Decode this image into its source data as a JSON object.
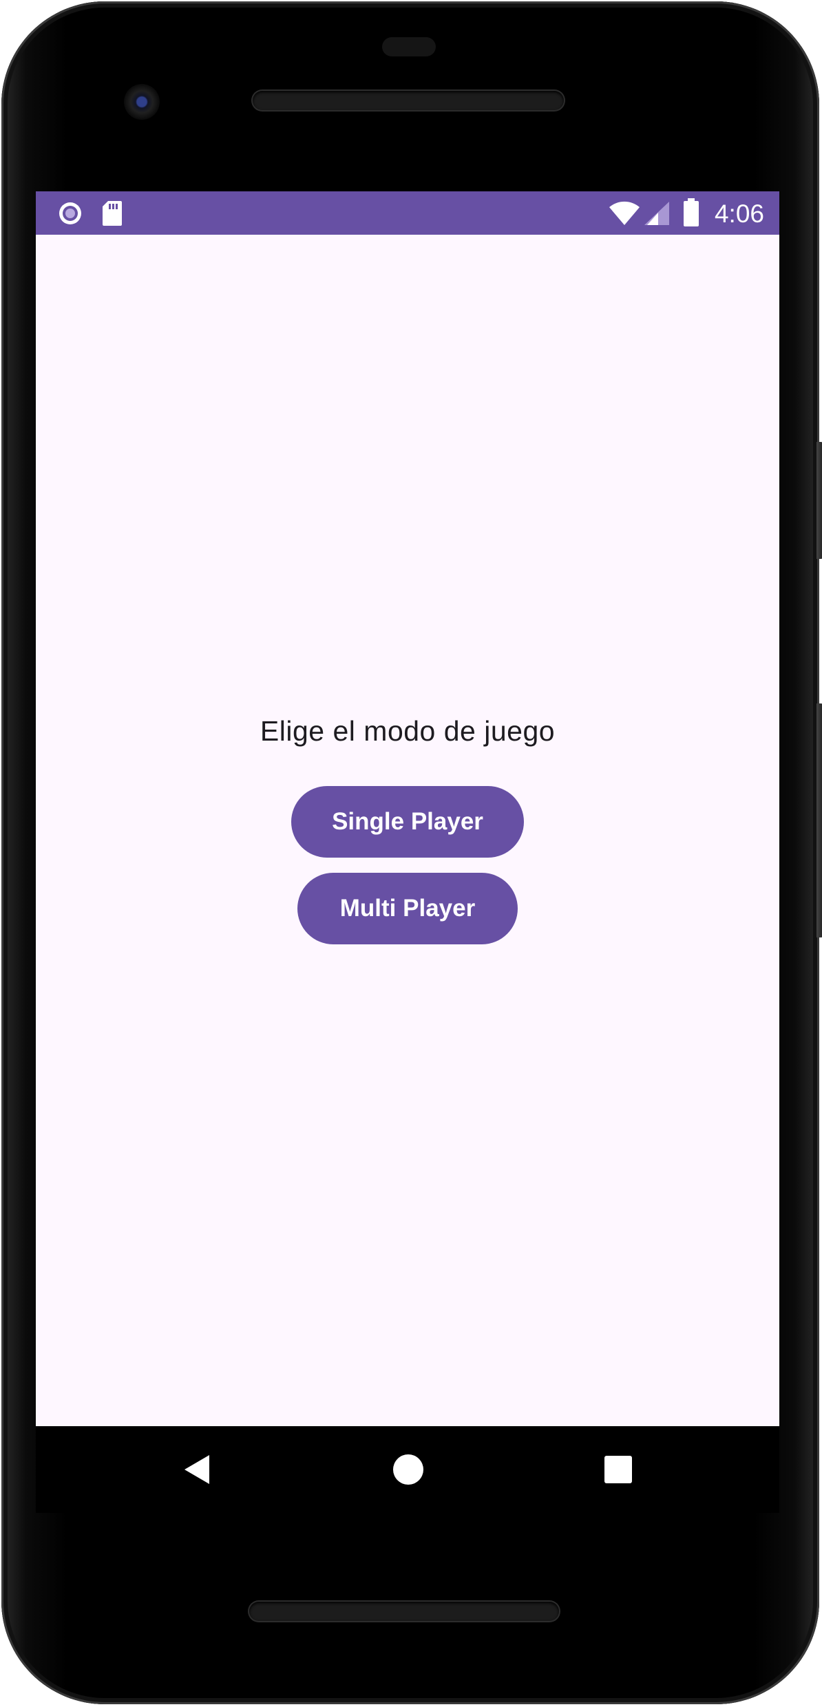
{
  "device": {
    "model": "Android phone"
  },
  "status_bar": {
    "time": "4:06",
    "background_color": "#6750a4",
    "left_icons": [
      "record-icon",
      "sd-card-icon"
    ],
    "right_icons": [
      "wifi-icon",
      "cell-signal-icon",
      "battery-icon"
    ]
  },
  "screen": {
    "background_color": "#fef7ff",
    "title": "Elige el modo de juego",
    "buttons": {
      "single_player": "Single Player",
      "multi_player": "Multi Player"
    },
    "accent_color": "#6750a4"
  },
  "navigation_bar": {
    "buttons": [
      "back-icon",
      "home-icon",
      "recents-icon"
    ]
  }
}
